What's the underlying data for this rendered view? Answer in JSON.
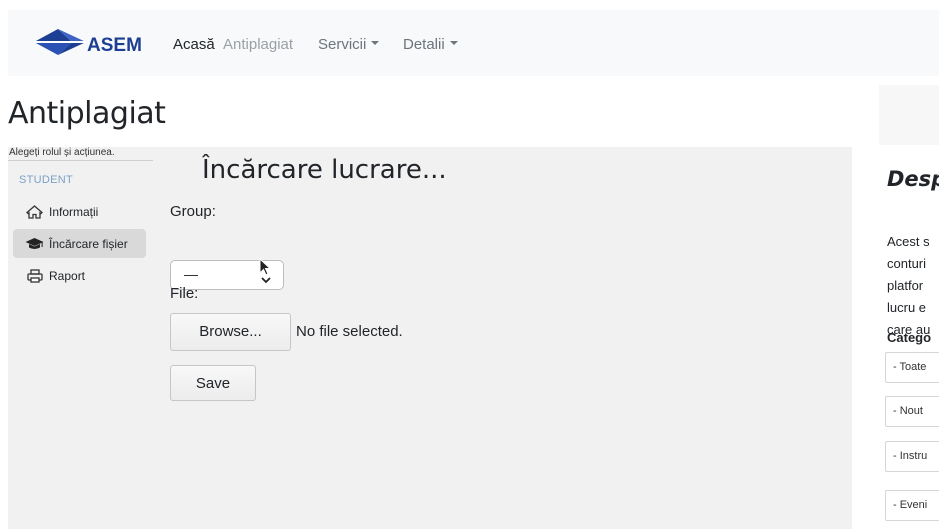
{
  "navbar": {
    "logo_text": "ASEM",
    "items": [
      {
        "label": "Acasă"
      },
      {
        "label": "Antiplagiat"
      },
      {
        "label": "Servicii"
      },
      {
        "label": "Detalii"
      }
    ]
  },
  "page_title": "Antiplagiat",
  "sidebar": {
    "header": "Alegeți rolul și acțiunea.",
    "section": "STUDENT",
    "items": [
      {
        "label": "Informații",
        "icon": "home-icon"
      },
      {
        "label": "Încărcare fișier",
        "icon": "graduation-cap-icon"
      },
      {
        "label": "Raport",
        "icon": "printer-icon"
      }
    ]
  },
  "form": {
    "title": "Încărcare lucrare...",
    "group_label": "Group:",
    "group_value": "—",
    "file_label": "File:",
    "browse_label": "Browse...",
    "file_status": "No file selected.",
    "save_label": "Save"
  },
  "right_panel": {
    "title": "Desp",
    "lines": [
      "Acest s",
      "conturi",
      "platfor",
      "lucru e",
      "care au"
    ],
    "categories_label": "Catego",
    "category_items": [
      "- Toate",
      "- Nout",
      "- Instru",
      "- Eveni"
    ]
  },
  "colors": {
    "navbar_bg": "#f8f9fa",
    "panel_bg": "#f1f1f1",
    "logo_blue": "#1c3f94",
    "section_blue": "#7ca0c8"
  }
}
